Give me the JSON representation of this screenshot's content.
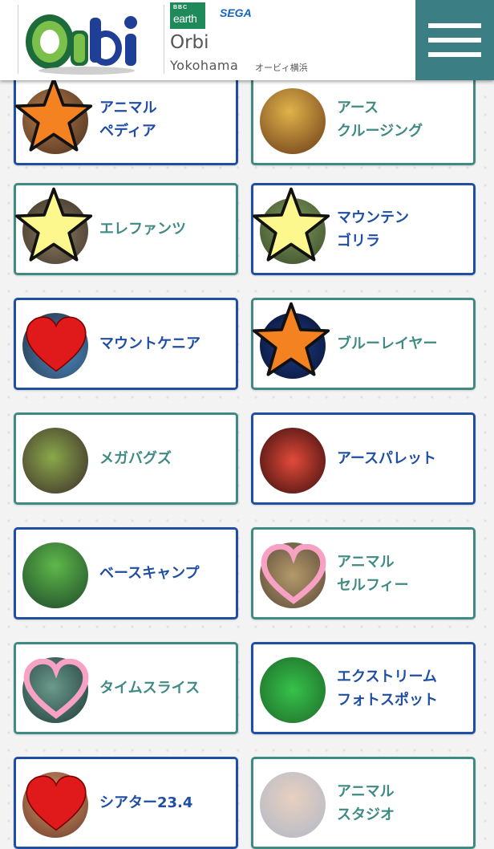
{
  "header": {
    "logo_text": "Orbi",
    "bbc_top": "BBC",
    "bbc_bottom": "earth",
    "sega": "SEGA",
    "title": "Orbi",
    "subtitle": "Yokohama",
    "subtitle_jp": "オービィ横浜"
  },
  "colors": {
    "blue": "#1f4ea3",
    "teal": "#3f8a82",
    "menu": "#3b7e84",
    "star_orange": "#f58220",
    "star_yellow": "#fdf88e",
    "heart_red": "#e01a1a",
    "heart_pink": "#f7a1c4"
  },
  "attractions": [
    {
      "line1": "アニマル",
      "line2": "ペディア",
      "marker": "orange-star-icon"
    },
    {
      "line1": "アース",
      "line2": "クルージング",
      "marker": ""
    },
    {
      "line1": "エレファンツ",
      "line2": "",
      "marker": "yellow-star-icon"
    },
    {
      "line1": "マウンテン",
      "line2": "ゴリラ",
      "marker": "yellow-star-icon"
    },
    {
      "line1": "マウントケニア",
      "line2": "",
      "marker": "red-heart-icon"
    },
    {
      "line1": "ブルーレイヤー",
      "line2": "",
      "marker": "orange-star-icon"
    },
    {
      "line1": "メガバグズ",
      "line2": "",
      "marker": ""
    },
    {
      "line1": "アースパレット",
      "line2": "",
      "marker": ""
    },
    {
      "line1": "ベースキャンプ",
      "line2": "",
      "marker": ""
    },
    {
      "line1": "アニマル",
      "line2": "セルフィー",
      "marker": "pink-heart-icon"
    },
    {
      "line1": "タイムスライス",
      "line2": "",
      "marker": "pink-heart-icon"
    },
    {
      "line1": "エクストリーム",
      "line2": "フォトスポット",
      "marker": ""
    },
    {
      "line1": "シアター23.4",
      "line2": "",
      "marker": "red-heart-icon"
    },
    {
      "line1": "アニマル",
      "line2": "スタジオ",
      "marker": ""
    }
  ]
}
